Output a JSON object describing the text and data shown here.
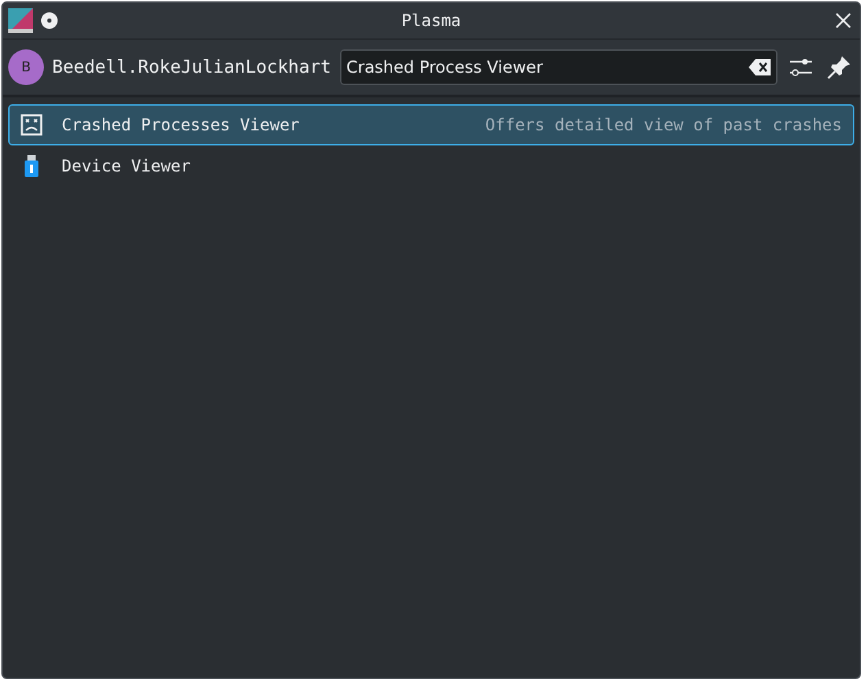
{
  "window": {
    "title": "Plasma"
  },
  "user": {
    "initial": "B",
    "name": "Beedell.RokeJulianLockhart"
  },
  "search": {
    "value": "Crashed Process Viewer"
  },
  "results": [
    {
      "kind": "crash",
      "title": "Crashed Processes Viewer",
      "subtitle": "Offers detailed view of past crashes",
      "selected": true
    },
    {
      "kind": "device",
      "title": "Device Viewer",
      "selected": false
    }
  ]
}
